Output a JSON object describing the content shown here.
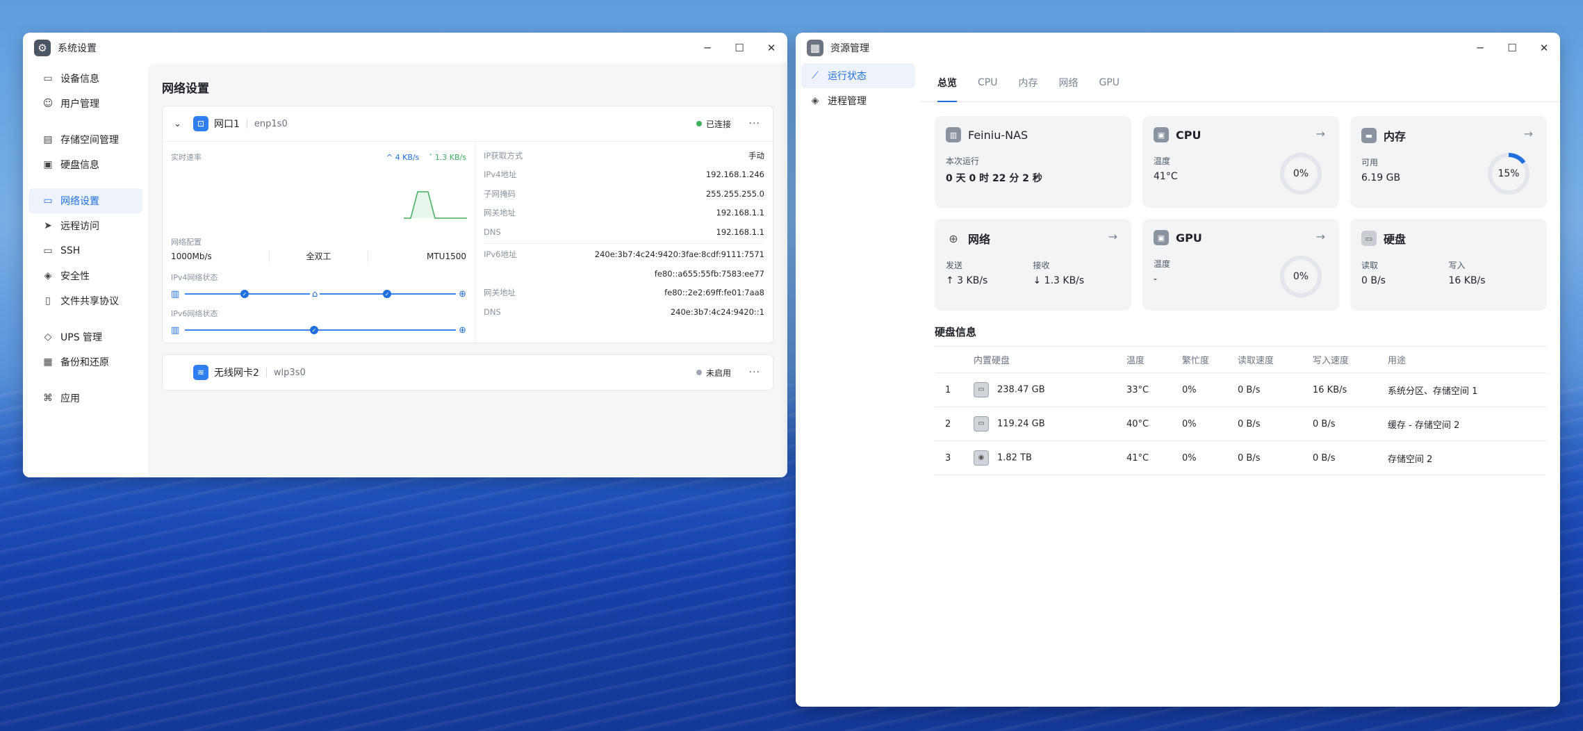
{
  "win1": {
    "title": "系统设置",
    "sidebar": [
      {
        "label": "设备信息",
        "icon": "monitor-icon"
      },
      {
        "label": "用户管理",
        "icon": "user-icon"
      },
      {
        "label": "存储空间管理",
        "icon": "storage-icon"
      },
      {
        "label": "硬盘信息",
        "icon": "disk-icon"
      },
      {
        "label": "网络设置",
        "icon": "network-icon",
        "active": true
      },
      {
        "label": "远程访问",
        "icon": "send-icon"
      },
      {
        "label": "SSH",
        "icon": "ssh-icon"
      },
      {
        "label": "安全性",
        "icon": "shield-icon"
      },
      {
        "label": "文件共享协议",
        "icon": "file-share-icon"
      },
      {
        "label": "UPS 管理",
        "icon": "ups-icon"
      },
      {
        "label": "备份和还原",
        "icon": "backup-icon"
      },
      {
        "label": "应用",
        "icon": "apps-icon"
      }
    ],
    "page_title": "网络设置",
    "iface1": {
      "name": "网口1",
      "device": "enp1s0",
      "status": "已连接",
      "status_color": "#3eaf5a",
      "realtime_label": "实时速率",
      "speed_up": "4 KB/s",
      "speed_down": "1.3 KB/s",
      "config_label": "网络配置",
      "link_speed": "1000Mb/s",
      "duplex": "全双工",
      "mtu": "MTU1500",
      "ipv4_status_label": "IPv4网络状态",
      "ipv6_status_label": "IPv6网络状态",
      "ipv4": [
        {
          "k": "IP获取方式",
          "v": "手动"
        },
        {
          "k": "IPv4地址",
          "v": "192.168.1.246"
        },
        {
          "k": "子网掩码",
          "v": "255.255.255.0"
        },
        {
          "k": "网关地址",
          "v": "192.168.1.1"
        },
        {
          "k": "DNS",
          "v": "192.168.1.1"
        }
      ],
      "ipv6": [
        {
          "k": "IPv6地址",
          "v": "240e:3b7:4c24:9420:3fae:8cdf:9111:7571"
        },
        {
          "k": "",
          "v": "fe80::a655:55fb:7583:ee77"
        },
        {
          "k": "网关地址",
          "v": "fe80::2e2:69ff:fe01:7aa8"
        },
        {
          "k": "DNS",
          "v": "240e:3b7:4c24:9420::1"
        }
      ]
    },
    "iface2": {
      "name": "无线网卡2",
      "device": "wlp3s0",
      "status": "未启用",
      "status_color": "#a0a7b1"
    }
  },
  "win2": {
    "title": "资源管理",
    "sidebar": [
      {
        "label": "运行状态",
        "icon": "chart-line-icon",
        "active": true
      },
      {
        "label": "进程管理",
        "icon": "layers-icon"
      }
    ],
    "tabs": [
      "总览",
      "CPU",
      "内存",
      "网络",
      "GPU"
    ],
    "tiles": {
      "device": {
        "title": "Feiniu-NAS",
        "label": "本次运行",
        "value": "0 天 0 时 22 分 2 秒"
      },
      "cpu": {
        "title": "CPU",
        "label": "温度",
        "value": "41°C",
        "percent": "0%",
        "level": 0
      },
      "mem": {
        "title": "内存",
        "label": "可用",
        "value": "6.19 GB",
        "percent": "15%",
        "level": 0.15
      },
      "net": {
        "title": "网络",
        "send_label": "发送",
        "send": "↑ 3 KB/s",
        "recv_label": "接收",
        "recv": "↓ 1.3 KB/s"
      },
      "gpu": {
        "title": "GPU",
        "label": "温度",
        "value": "-",
        "percent": "0%",
        "level": 0
      },
      "disk": {
        "title": "硬盘",
        "read_label": "读取",
        "read": "0 B/s",
        "write_label": "写入",
        "write": "16 KB/s"
      }
    },
    "disk_section_title": "硬盘信息",
    "disk_table": {
      "headers": [
        "",
        "内置硬盘",
        "温度",
        "繁忙度",
        "读取速度",
        "写入速度",
        "用途"
      ],
      "rows": [
        [
          "1",
          "238.47 GB",
          "33°C",
          "0%",
          "0 B/s",
          "16 KB/s",
          "系统分区、存储空间 1"
        ],
        [
          "2",
          "119.24 GB",
          "40°C",
          "0%",
          "0 B/s",
          "0 B/s",
          "缓存 - 存储空间 2"
        ],
        [
          "3",
          "1.82 TB",
          "41°C",
          "0%",
          "0 B/s",
          "0 B/s",
          "存储空间 2"
        ]
      ]
    }
  },
  "colors": {
    "accent": "#1f6fde"
  }
}
